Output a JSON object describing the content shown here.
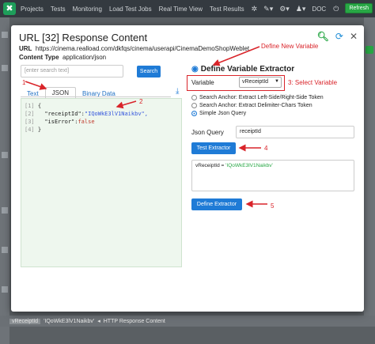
{
  "navbar": {
    "items": [
      "Projects",
      "Tests",
      "Monitoring",
      "Load Test Jobs",
      "Real Time View",
      "Test Results"
    ],
    "doc_label": "DOC",
    "refresh_label": "Refresh"
  },
  "modal": {
    "title": "URL [32] Response Content",
    "url_label": "URL",
    "url_value": "https://cinema.realload.com/dkfqs/cinema/userapi/CinemaDemoShopWeblet",
    "content_type_label": "Content Type",
    "content_type_value": "application/json"
  },
  "left_pane": {
    "search_placeholder": "[enter search text]",
    "search_button": "Search",
    "tabs": [
      "Text",
      "JSON",
      "Binary Data"
    ],
    "active_tab": "JSON",
    "code": {
      "line1_no": "[1]",
      "line1": "{",
      "line2_no": "[2]",
      "line2_key": "\"receiptId\":",
      "line2_val": "\"IQoWkE3lV1Naikbv\",",
      "line3_no": "[3]",
      "line3_key": "\"isError\":",
      "line3_val": "false",
      "line4_no": "[4]",
      "line4": "}"
    }
  },
  "extractor": {
    "title": "Define Variable Extractor",
    "variable_label": "Variable",
    "variable_value": "vReceiptId",
    "radio_options": [
      "Search Anchor: Extract Left-Side/Right-Side Token",
      "Search Anchor: Extract Delimiter-Chars Token",
      "Simple Json Query"
    ],
    "selected_radio": 2,
    "json_query_label": "Json Query",
    "json_query_value": "receiptId",
    "test_button": "Test Extractor",
    "result_name": "vReceiptId",
    "result_eq": " = ",
    "result_value": "'IQoWkE3lV1Naikbv'",
    "define_button": "Define Extractor"
  },
  "annotations": {
    "define_new_variable": "Define New Variable",
    "select_variable": "3: Select Variable",
    "n1": "1",
    "n2": "2",
    "n4": "4",
    "n5": "5"
  },
  "footer": {
    "tag_var": "vReceiptId",
    "tag_val": "'IQoWkE3lV1Naikbv'",
    "source": "HTTP Response Content"
  },
  "colors": {
    "accent_blue": "#1f7bd6",
    "annotation_red": "#d9242a",
    "nav_dark": "#343a40",
    "refresh_green": "#28a745"
  }
}
